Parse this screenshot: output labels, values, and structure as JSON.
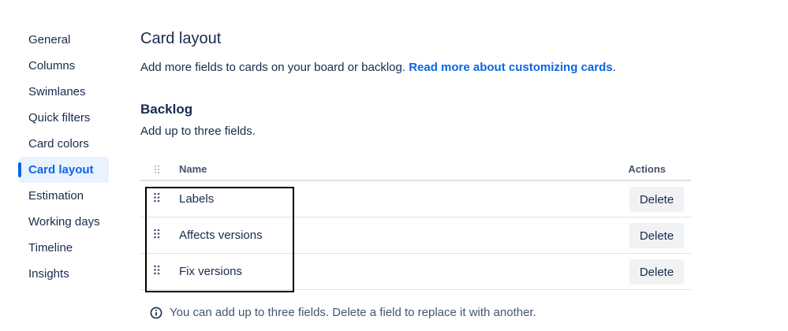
{
  "sidebar": {
    "items": [
      {
        "label": "General"
      },
      {
        "label": "Columns"
      },
      {
        "label": "Swimlanes"
      },
      {
        "label": "Quick filters"
      },
      {
        "label": "Card colors"
      },
      {
        "label": "Card layout",
        "active": true
      },
      {
        "label": "Estimation"
      },
      {
        "label": "Working days"
      },
      {
        "label": "Timeline"
      },
      {
        "label": "Insights"
      }
    ]
  },
  "main": {
    "title": "Card layout",
    "intro_text": "Add more fields to cards on your board or backlog. ",
    "intro_link": "Read more about customizing cards",
    "intro_suffix": ".",
    "section": {
      "title": "Backlog",
      "description": "Add up to three fields."
    },
    "table": {
      "columns": {
        "name": "Name",
        "actions": "Actions"
      },
      "rows": [
        {
          "label": "Labels",
          "action": "Delete"
        },
        {
          "label": "Affects versions",
          "action": "Delete"
        },
        {
          "label": "Fix versions",
          "action": "Delete"
        }
      ]
    },
    "info_text": "You can add up to three fields. Delete a field to replace it with another."
  },
  "colors": {
    "accent": "#0c66e4",
    "text": "#172b4d",
    "subtle_text": "#44546f",
    "active_bg": "#e9f2ff",
    "button_bg": "#f1f2f4",
    "border": "#dfe1e6"
  },
  "icons": {
    "drag": "drag-handle-icon",
    "info": "info-icon"
  }
}
